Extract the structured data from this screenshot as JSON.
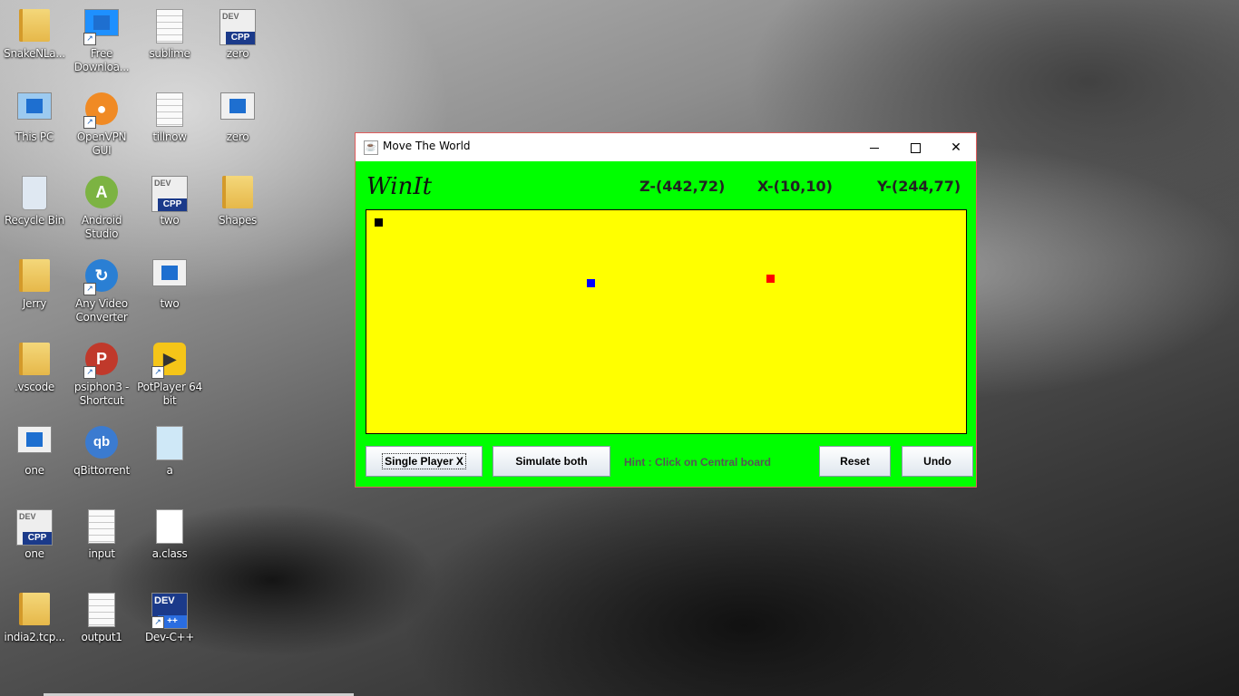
{
  "desktop": {
    "icons": [
      {
        "label": "SnakeNLa..."
      },
      {
        "label": "Free\nDownloa..."
      },
      {
        "label": "sublime"
      },
      {
        "label": "zero"
      },
      {
        "label": "This PC"
      },
      {
        "label": "OpenVPN\nGUI"
      },
      {
        "label": "tillnow"
      },
      {
        "label": "zero"
      },
      {
        "label": "Recycle Bin"
      },
      {
        "label": "Android\nStudio"
      },
      {
        "label": "two"
      },
      {
        "label": "Shapes"
      },
      {
        "label": "Jerry"
      },
      {
        "label": "Any Video\nConverter"
      },
      {
        "label": "two"
      },
      {
        "label": ".vscode"
      },
      {
        "label": "psiphon3 -\nShortcut"
      },
      {
        "label": "PotPlayer 64\nbit"
      },
      {
        "label": "one"
      },
      {
        "label": "qBittorrent"
      },
      {
        "label": "a"
      },
      {
        "label": "one"
      },
      {
        "label": "input"
      },
      {
        "label": "a.class"
      },
      {
        "label": "india2.tcp..."
      },
      {
        "label": "output1"
      },
      {
        "label": "Dev-C++"
      }
    ]
  },
  "window": {
    "title": "Move The World",
    "minimize": "—",
    "close": "✕"
  },
  "header": {
    "win_label": "WinIt",
    "coord_z": "Z-(442,72)",
    "coord_x": "X-(10,10)",
    "coord_y": "Y-(244,77)"
  },
  "board": {
    "background_color": "#ffff00",
    "pieces": [
      {
        "name": "piece-x",
        "color": "#000000"
      },
      {
        "name": "piece-y",
        "color": "#0000ff"
      },
      {
        "name": "piece-z",
        "color": "#ff0000"
      }
    ]
  },
  "controls": {
    "single_player": "Single Player X",
    "simulate": "Simulate both",
    "hint": "Hint : Click on Central board",
    "reset": "Reset",
    "undo": "Undo"
  },
  "colors": {
    "window_bg": "#00ff00",
    "board_bg": "#ffff00"
  }
}
